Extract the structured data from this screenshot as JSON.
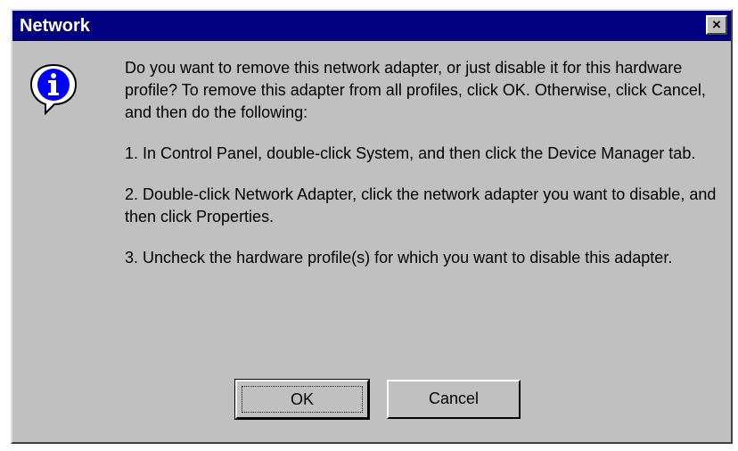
{
  "window": {
    "title": "Network",
    "close_label": "×"
  },
  "icon": "information-icon",
  "message": {
    "intro": "Do you want to remove this network adapter, or just disable it for this hardware profile?  To remove this adapter from all profiles, click OK. Otherwise, click Cancel, and then do the following:",
    "step1": "1.  In Control Panel, double-click System, and then click the Device Manager tab.",
    "step2": "2.  Double-click Network Adapter, click the network adapter you want to disable, and then click Properties.",
    "step3": "3.  Uncheck the hardware profile(s) for which you want to disable this adapter."
  },
  "buttons": {
    "ok": "OK",
    "cancel": "Cancel"
  },
  "colors": {
    "titlebar": "#000080",
    "face": "#c0c0c0",
    "icon_blue": "#0000ff"
  }
}
